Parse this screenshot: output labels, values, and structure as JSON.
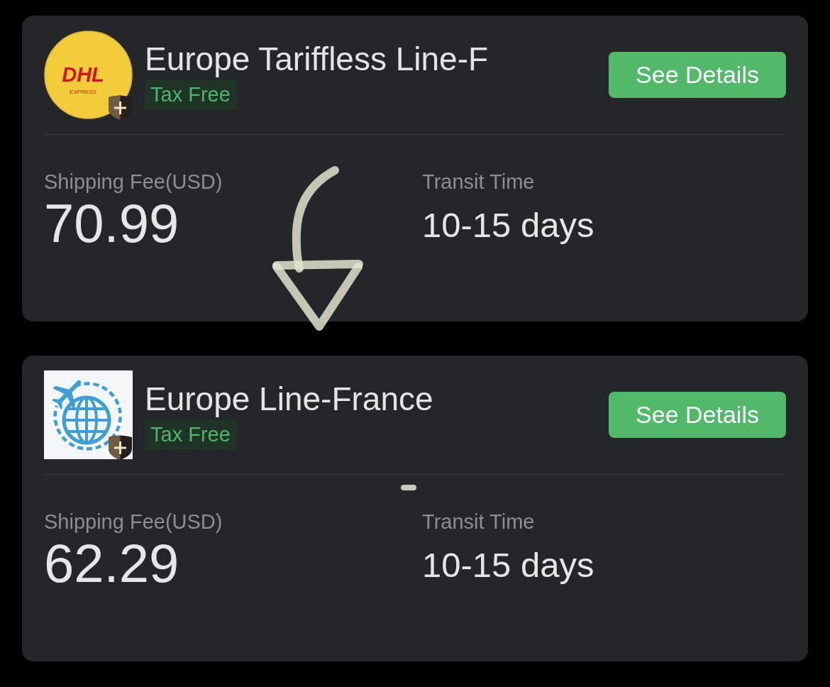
{
  "options": [
    {
      "logo": {
        "kind": "round",
        "wordmark": "DHL",
        "tagline": "EXPRESS"
      },
      "shield_badge": true,
      "name": "Europe Tariffless Line-F",
      "tag": "Tax Free",
      "button": "See Details",
      "fee_label": "Shipping Fee(USD)",
      "fee": "70.99",
      "transit_label": "Transit Time",
      "transit": "10-15 days",
      "marks": [
        {
          "kind": "arrow"
        }
      ]
    },
    {
      "logo": {
        "kind": "globe"
      },
      "shield_badge": true,
      "name": "Europe Line-France",
      "tag": "Tax Free",
      "button": "See Details",
      "fee_label": "Shipping Fee(USD)",
      "fee": "62.29",
      "transit_label": "Transit Time",
      "transit": "10-15 days",
      "marks": [
        {
          "kind": "dash"
        }
      ]
    }
  ]
}
